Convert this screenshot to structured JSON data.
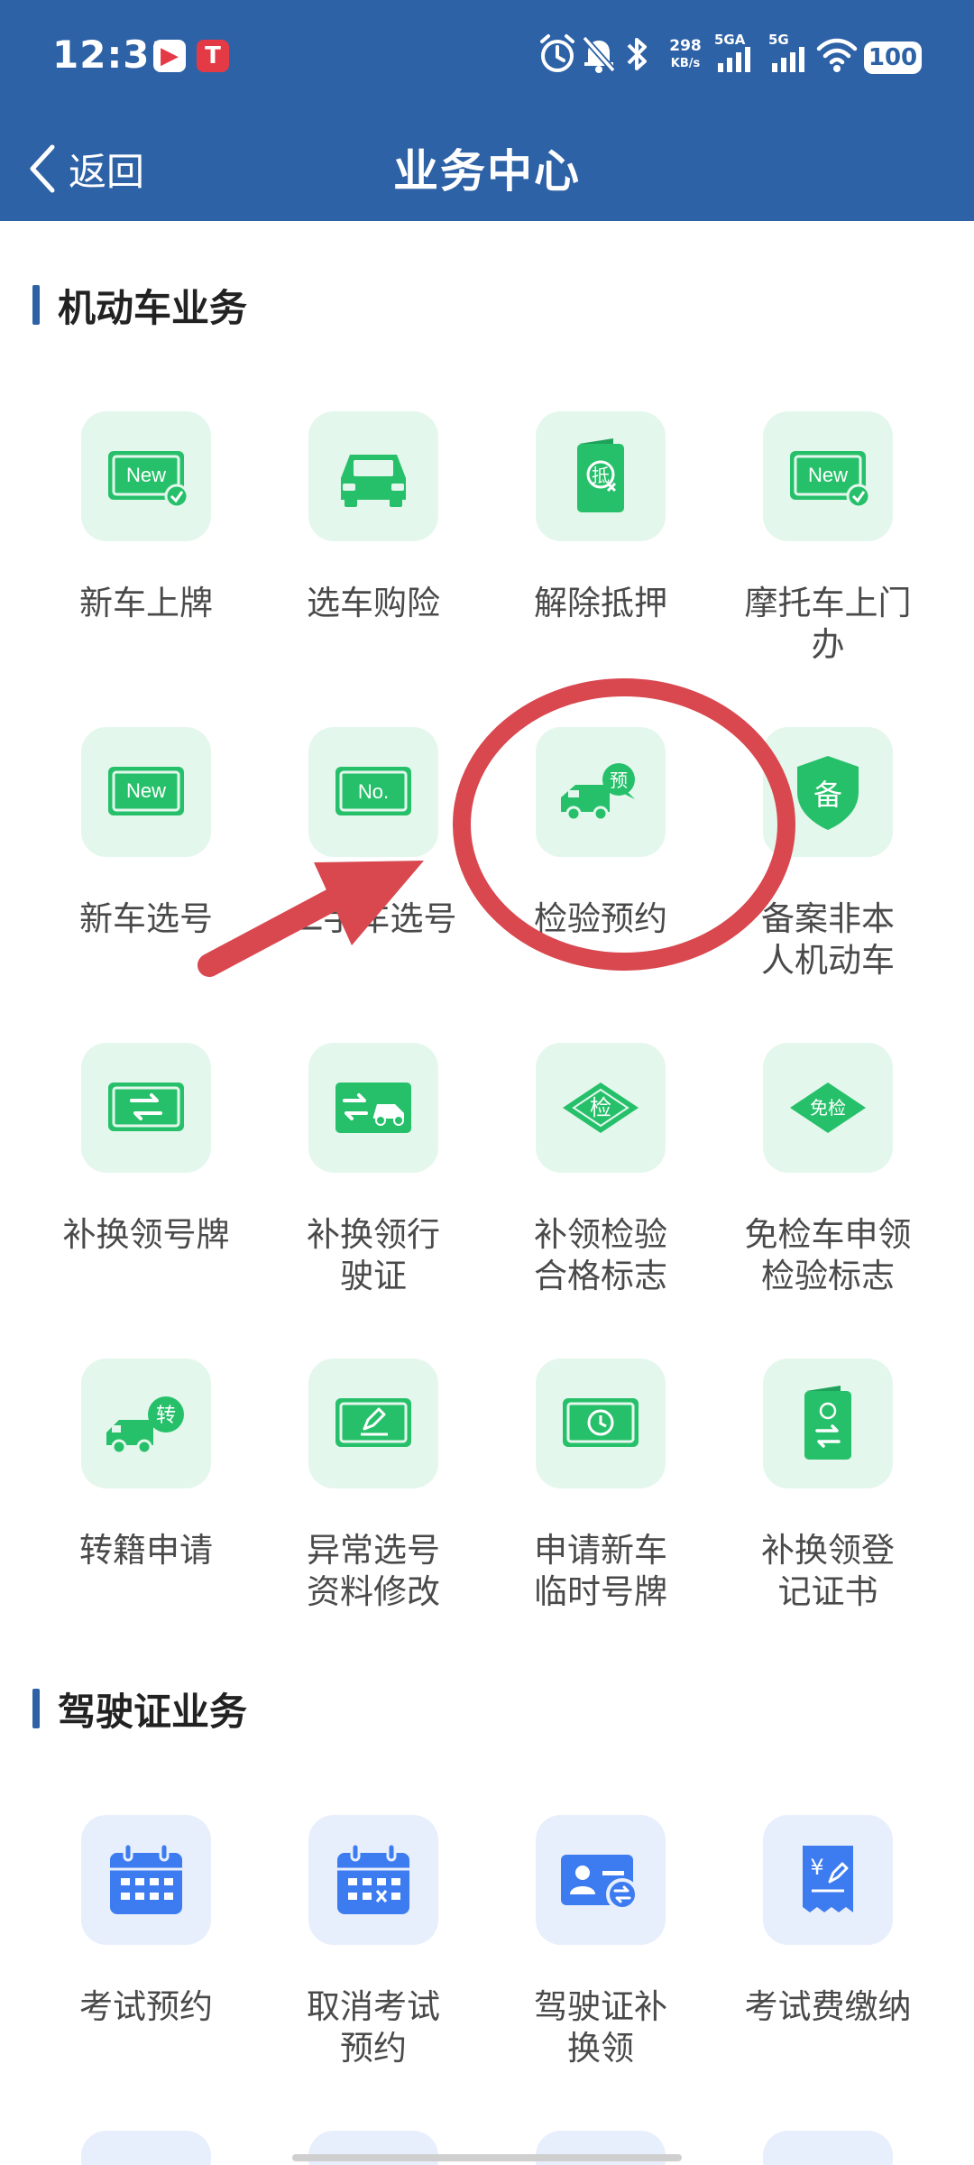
{
  "status_bar": {
    "time": "12:31",
    "app_icon_1": "▶",
    "app_icon_2": "T",
    "speed_value": "298",
    "speed_unit": "KB/s",
    "signal_1": "5GA",
    "signal_2": "5G",
    "battery": "100"
  },
  "nav": {
    "back_label": "返回",
    "title": "业务中心"
  },
  "sections": [
    {
      "title": "机动车业务",
      "items": [
        {
          "label": "新车上牌",
          "icon": "new-plate-icon",
          "glyph": "New"
        },
        {
          "label": "选车购险",
          "icon": "car-icon",
          "glyph": ""
        },
        {
          "label": "解除抵押",
          "icon": "release-mortgage-icon",
          "glyph": "抵"
        },
        {
          "label": "摩托车上门办",
          "icon": "motorcycle-new-plate-icon",
          "glyph": "New"
        },
        {
          "label": "新车选号",
          "icon": "new-number-icon",
          "glyph": "New"
        },
        {
          "label": "二手车选号",
          "icon": "number-plate-icon",
          "glyph": "No."
        },
        {
          "label": "检验预约",
          "icon": "inspection-booking-icon",
          "glyph": "预"
        },
        {
          "label": "备案非本人机动车",
          "icon": "record-shield-icon",
          "glyph": "备"
        },
        {
          "label": "补换领号牌",
          "icon": "plate-exchange-icon",
          "glyph": ""
        },
        {
          "label": "补换领行驶证",
          "icon": "license-exchange-icon",
          "glyph": ""
        },
        {
          "label": "补领检验合格标志",
          "icon": "inspection-mark-icon",
          "glyph": "检"
        },
        {
          "label": "免检车申领检验标志",
          "icon": "exempt-inspection-icon",
          "glyph": "免检"
        },
        {
          "label": "转籍申请",
          "icon": "transfer-truck-icon",
          "glyph": "转"
        },
        {
          "label": "异常选号资料修改",
          "icon": "edit-plate-icon",
          "glyph": ""
        },
        {
          "label": "申请新车临时号牌",
          "icon": "temporary-plate-icon",
          "glyph": ""
        },
        {
          "label": "补换领登记证书",
          "icon": "registration-certificate-icon",
          "glyph": ""
        }
      ]
    },
    {
      "title": "驾驶证业务",
      "items": [
        {
          "label": "考试预约",
          "icon": "calendar-icon",
          "glyph": ""
        },
        {
          "label": "取消考试预约",
          "icon": "calendar-cancel-icon",
          "glyph": ""
        },
        {
          "label": "驾驶证补换领",
          "icon": "driver-license-icon",
          "glyph": ""
        },
        {
          "label": "考试费缴纳",
          "icon": "fee-payment-icon",
          "glyph": "¥"
        }
      ]
    }
  ],
  "colors": {
    "header_bg": "#2e62a6",
    "green_icon": "#27c06a",
    "green_tile": "#e4f7ec",
    "blue_icon": "#3d7cf0",
    "blue_tile": "#e7eefc",
    "annotation_red": "#d9474f"
  }
}
